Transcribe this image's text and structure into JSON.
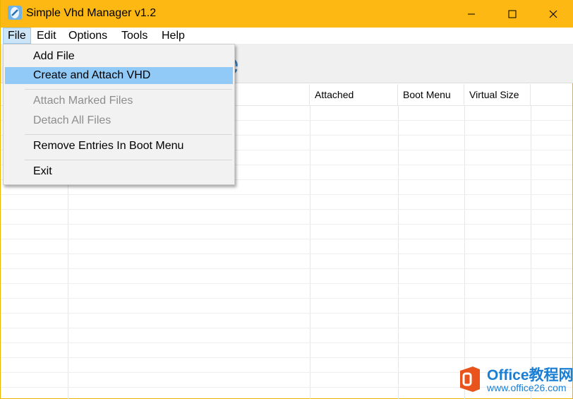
{
  "window": {
    "title": "Simple Vhd Manager v1.2",
    "accent_color": "#fdb813",
    "icons": {
      "app": "vhd-app-icon",
      "minimize": "minimize-icon",
      "maximize": "maximize-icon",
      "close": "close-icon"
    }
  },
  "menubar": {
    "items": [
      {
        "label": "File",
        "active": true
      },
      {
        "label": "Edit"
      },
      {
        "label": "Options"
      },
      {
        "label": "Tools"
      },
      {
        "label": "Help"
      }
    ]
  },
  "file_menu": {
    "items": [
      {
        "label": "Add File",
        "enabled": true
      },
      {
        "label": "Create and Attach VHD",
        "enabled": true,
        "highlighted": true
      },
      {
        "label": "Attach Marked Files",
        "enabled": false
      },
      {
        "label": "Detach All Files",
        "enabled": false
      },
      {
        "label": "Remove Entries In Boot Menu",
        "enabled": true
      },
      {
        "label": "Exit",
        "enabled": true
      }
    ],
    "highlight_color": "#91c9f7"
  },
  "grid": {
    "columns": [
      "Attached",
      "Boot Menu",
      "Virtual Size"
    ]
  },
  "watermark": {
    "title": "Office教程网",
    "url": "www.office26.com",
    "icon": "office-logo-icon"
  }
}
